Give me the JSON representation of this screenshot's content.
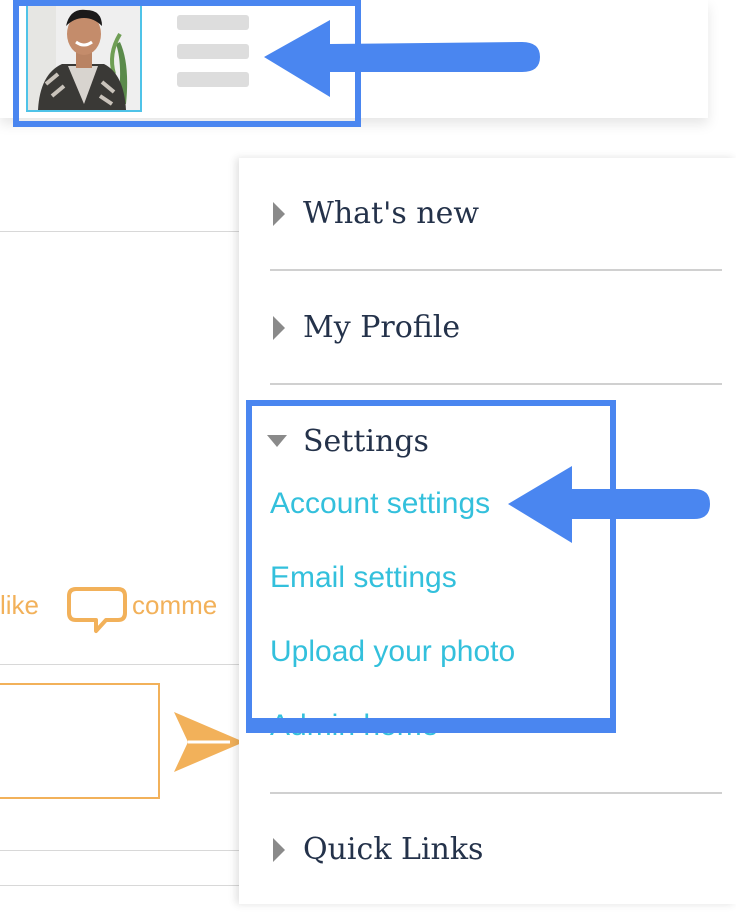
{
  "menu": {
    "items": [
      {
        "label": "What's new",
        "expanded": false
      },
      {
        "label": "My Profile",
        "expanded": false
      },
      {
        "label": "Settings",
        "expanded": true
      },
      {
        "label": "Quick Links",
        "expanded": false
      }
    ],
    "settings_links": [
      "Account settings",
      "Email settings",
      "Upload your photo",
      "Admin home"
    ]
  },
  "feed": {
    "like_label": "like",
    "comment_label": "comme"
  },
  "colors": {
    "highlight": "#4a86f0",
    "link": "#33c0dc",
    "accent": "#f2b15a",
    "menu_text": "#24324a"
  },
  "icons": {
    "menu": "hamburger-icon",
    "expand": "triangle-right-icon",
    "collapse": "triangle-down-icon",
    "comment": "speech-bubble-icon",
    "send": "paper-plane-icon"
  }
}
